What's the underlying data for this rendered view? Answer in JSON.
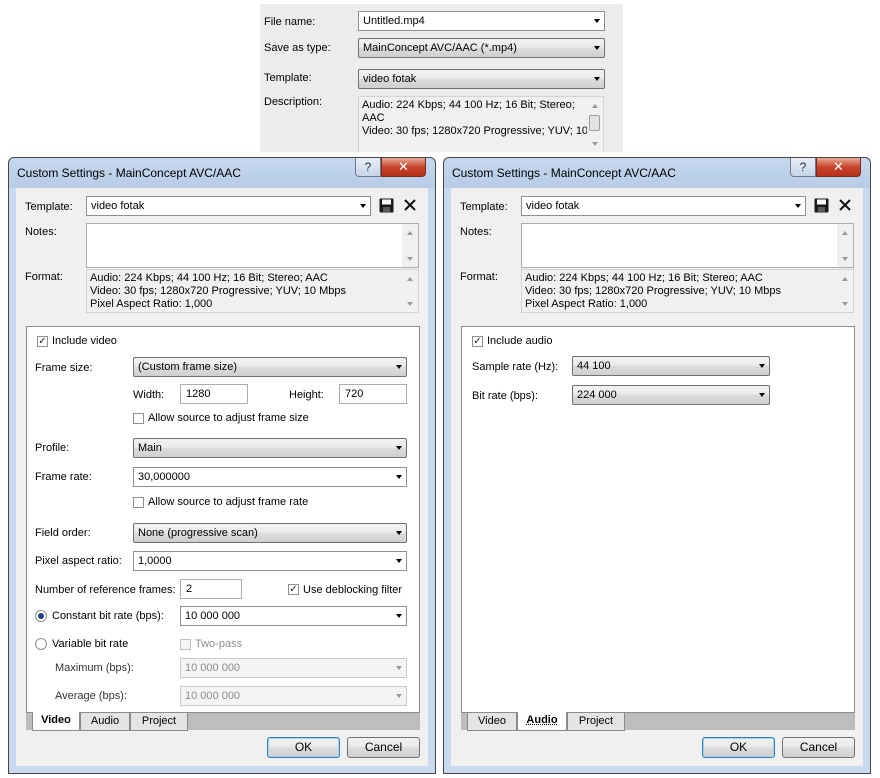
{
  "save_panel": {
    "file_name_label": "File name:",
    "file_name_value": "Untitled.mp4",
    "save_as_type_label": "Save as type:",
    "save_as_type_value": "MainConcept AVC/AAC (*.mp4)",
    "template_label": "Template:",
    "template_value": "video fotak",
    "description_label": "Description:",
    "description_lines": [
      "Audio: 224 Kbps; 44 100 Hz; 16 Bit; Stereo;",
      "AAC",
      "Video: 30 fps; 1280x720 Progressive; YUV; 10"
    ]
  },
  "dialog_video": {
    "title": "Custom Settings - MainConcept AVC/AAC",
    "help_glyph": "?",
    "close_glyph": "✕",
    "template_label": "Template:",
    "template_value": "video fotak",
    "notes_label": "Notes:",
    "notes_value": "",
    "format_label": "Format:",
    "format_lines": [
      "Audio: 224 Kbps; 44 100 Hz; 16 Bit; Stereo; AAC",
      "Video: 30 fps; 1280x720 Progressive; YUV; 10 Mbps",
      "Pixel Aspect Ratio: 1,000"
    ],
    "include_video_label": "Include video",
    "include_video_checked": true,
    "frame_size_label": "Frame size:",
    "frame_size_value": "(Custom frame size)",
    "width_label": "Width:",
    "width_value": "1280",
    "height_label": "Height:",
    "height_value": "720",
    "allow_frame_size_label": "Allow source to adjust frame size",
    "profile_label": "Profile:",
    "profile_value": "Main",
    "frame_rate_label": "Frame rate:",
    "frame_rate_value": "30,000000",
    "allow_frame_rate_label": "Allow source to adjust frame rate",
    "field_order_label": "Field order:",
    "field_order_value": "None (progressive scan)",
    "pixel_aspect_label": "Pixel aspect ratio:",
    "pixel_aspect_value": "1,0000",
    "ref_frames_label": "Number of reference frames:",
    "ref_frames_value": "2",
    "deblocking_label": "Use deblocking filter",
    "deblocking_checked": true,
    "cbr_label": "Constant bit rate (bps):",
    "cbr_value": "10 000 000",
    "vbr_label": "Variable bit rate",
    "two_pass_label": "Two-pass",
    "maximum_label": "Maximum (bps):",
    "maximum_value": "10 000 000",
    "average_label": "Average (bps):",
    "average_value": "10 000 000",
    "tabs": [
      "Video",
      "Audio",
      "Project"
    ],
    "active_tab": "Video",
    "ok_label": "OK",
    "cancel_label": "Cancel"
  },
  "dialog_audio": {
    "title": "Custom Settings - MainConcept AVC/AAC",
    "help_glyph": "?",
    "close_glyph": "✕",
    "template_label": "Template:",
    "template_value": "video fotak",
    "notes_label": "Notes:",
    "notes_value": "",
    "format_label": "Format:",
    "format_lines": [
      "Audio: 224 Kbps; 44 100 Hz; 16 Bit; Stereo; AAC",
      "Video: 30 fps; 1280x720 Progressive; YUV; 10 Mbps",
      "Pixel Aspect Ratio: 1,000"
    ],
    "include_audio_label": "Include audio",
    "include_audio_checked": true,
    "sample_rate_label": "Sample rate (Hz):",
    "sample_rate_value": "44 100",
    "bit_rate_label": "Bit rate (bps):",
    "bit_rate_value": "224 000",
    "tabs": [
      "Video",
      "Audio",
      "Project"
    ],
    "active_tab": "Audio",
    "ok_label": "OK",
    "cancel_label": "Cancel"
  },
  "icons": {
    "save": "floppy-disk-icon",
    "delete": "x-delete-icon",
    "check": "✓"
  }
}
